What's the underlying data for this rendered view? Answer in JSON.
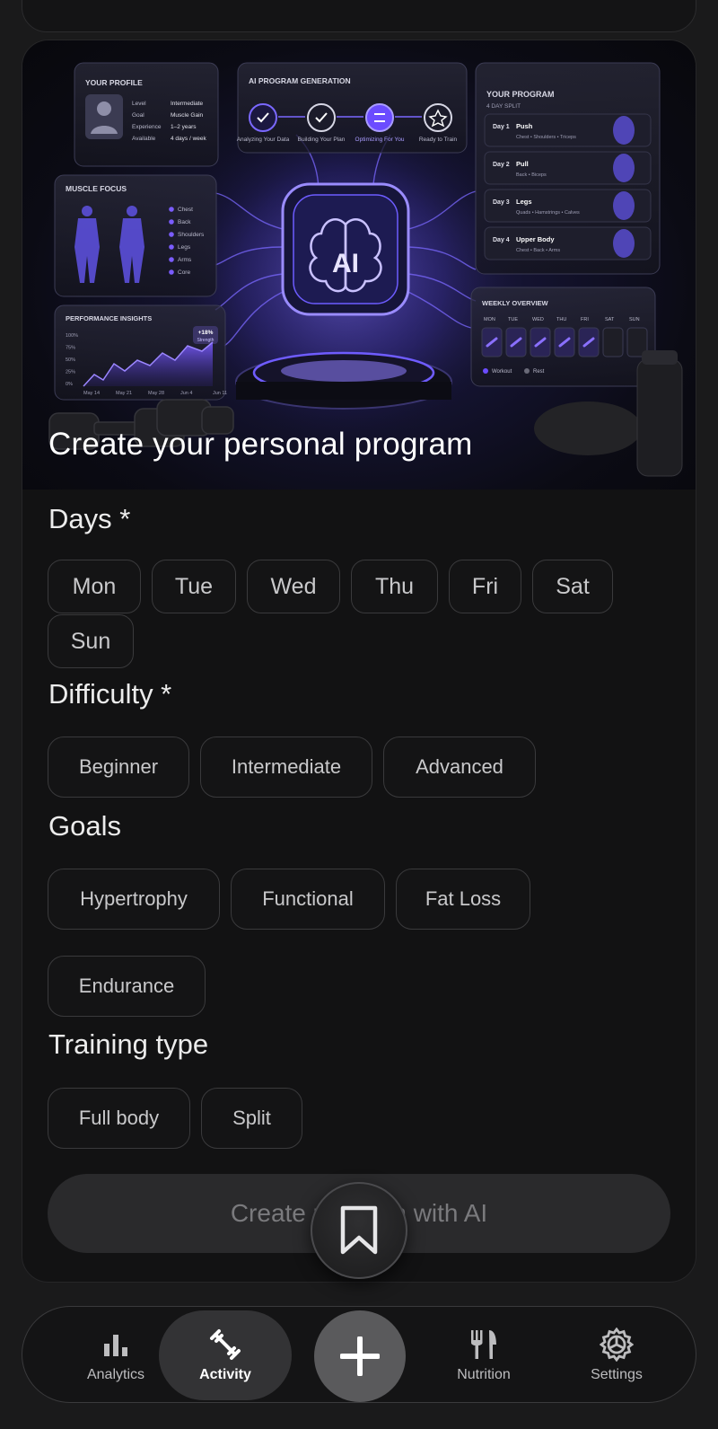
{
  "hero": {
    "title": "Create your personal program",
    "profile": {
      "heading": "YOUR PROFILE",
      "rows": [
        {
          "k": "Level",
          "v": "Intermediate"
        },
        {
          "k": "Goal",
          "v": "Muscle Gain"
        },
        {
          "k": "Experience",
          "v": "1–2 years"
        },
        {
          "k": "Available",
          "v": "4 days / week"
        }
      ]
    },
    "generation": {
      "heading": "AI PROGRAM GENERATION",
      "steps": [
        "Analyzing Your Data",
        "Building Your Plan",
        "Optimizing For You",
        "Ready to Train"
      ]
    },
    "program": {
      "heading": "YOUR PROGRAM",
      "sub": "4 DAY SPLIT",
      "days": [
        {
          "day": "Day 1",
          "name": "Push",
          "detail": "Chest • Shoulders • Triceps"
        },
        {
          "day": "Day 2",
          "name": "Pull",
          "detail": "Back • Biceps"
        },
        {
          "day": "Day 3",
          "name": "Legs",
          "detail": "Quads • Hamstrings • Calves"
        },
        {
          "day": "Day 4",
          "name": "Upper Body",
          "detail": "Chest • Back • Arms"
        }
      ]
    },
    "muscle": {
      "heading": "MUSCLE FOCUS",
      "items": [
        "Chest",
        "Back",
        "Shoulders",
        "Legs",
        "Arms",
        "Core"
      ]
    },
    "performance": {
      "heading": "PERFORMANCE INSIGHTS",
      "badge": "+18%",
      "badge_sub": "Strength",
      "y_ticks": [
        "100%",
        "75%",
        "50%",
        "25%",
        "0%"
      ],
      "x_ticks": [
        "May 14",
        "May 21",
        "May 28",
        "Jun 4",
        "Jun 11"
      ]
    },
    "weekly": {
      "heading": "WEEKLY OVERVIEW",
      "days": [
        "MON",
        "TUE",
        "WED",
        "THU",
        "FRI",
        "SAT",
        "SUN"
      ],
      "legend_workout": "Workout",
      "legend_rest": "Rest"
    },
    "brain_label": "AI"
  },
  "days": {
    "title": "Days *",
    "options": [
      "Mon",
      "Tue",
      "Wed",
      "Thu",
      "Fri",
      "Sat",
      "Sun"
    ]
  },
  "difficulty": {
    "title": "Difficulty *",
    "options": [
      "Beginner",
      "Intermediate",
      "Advanced"
    ]
  },
  "goals": {
    "title": "Goals",
    "options": [
      "Hypertrophy",
      "Functional",
      "Fat Loss",
      "Endurance"
    ]
  },
  "training": {
    "title": "Training type",
    "options": [
      "Full body",
      "Split"
    ]
  },
  "cta_label": "Create program with AI",
  "tabs": {
    "analytics": "Analytics",
    "activity": "Activity",
    "nutrition": "Nutrition",
    "settings": "Settings"
  },
  "colors": {
    "accent": "#6b4cff",
    "background": "#1a1a1b",
    "card": "#121213"
  },
  "icons": {
    "analytics": "bar-chart-icon",
    "activity": "dumbbell-icon",
    "add": "plus-icon",
    "nutrition": "fork-knife-icon",
    "settings": "gear-icon",
    "bookmark": "bookmark-icon"
  }
}
